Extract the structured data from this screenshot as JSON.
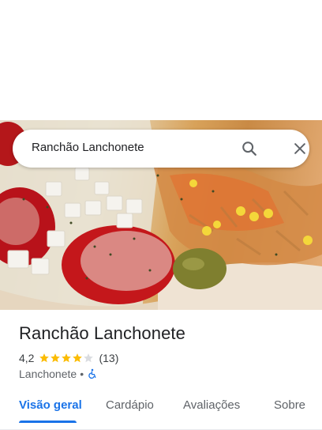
{
  "search": {
    "query": "Ranchão Lanchonete",
    "search_icon": "search-icon",
    "close_icon": "close-icon"
  },
  "place": {
    "name": "Ranchão Lanchonete",
    "rating": "4,2",
    "rating_stars": 4.2,
    "reviews": "(13)",
    "category": "Lanchonete",
    "separator": "•",
    "accessibility_icon": "wheelchair-accessible-icon"
  },
  "tabs": [
    {
      "label": "Visão geral",
      "active": true
    },
    {
      "label": "Cardápio",
      "active": false
    },
    {
      "label": "Avaliações",
      "active": false
    },
    {
      "label": "Sobre",
      "active": false
    }
  ],
  "colors": {
    "accent": "#1a73e8",
    "star": "#fbbc04",
    "star_empty": "#dadce0"
  }
}
